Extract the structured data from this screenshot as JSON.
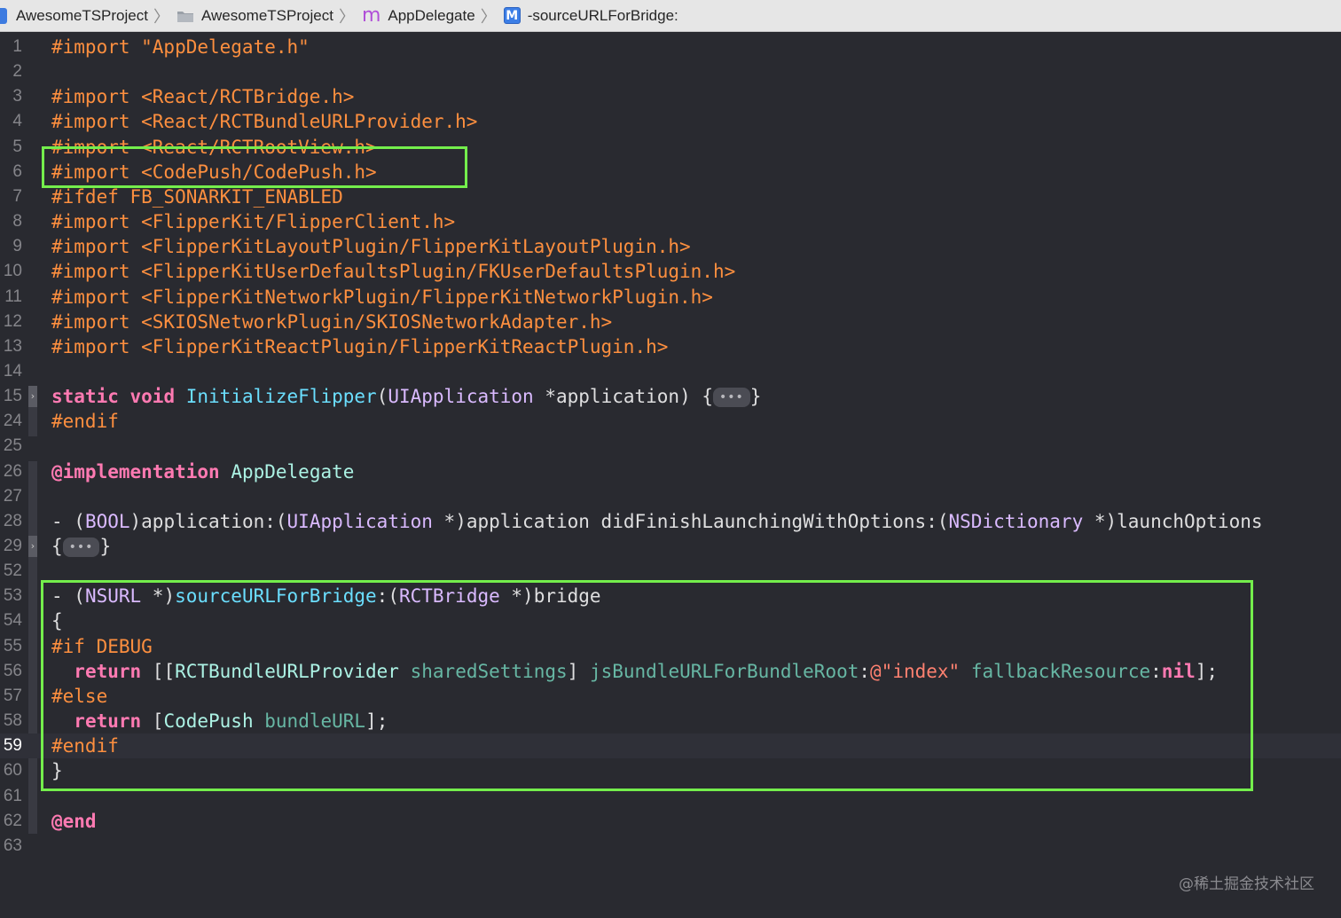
{
  "jump_bar": {
    "project": "AwesomeTSProject",
    "group": "AwesomeTSProject",
    "file_icon_glyph": "m",
    "file": "AppDelegate",
    "method_icon_glyph": "M",
    "method": "-sourceURLForBridge:"
  },
  "editor": {
    "current_line": "59",
    "lines": [
      {
        "n": "1",
        "t": "#import \"AppDelegate.h\""
      },
      {
        "n": "2",
        "t": ""
      },
      {
        "n": "3",
        "t": "#import <React/RCTBridge.h>"
      },
      {
        "n": "4",
        "t": "#import <React/RCTBundleURLProvider.h>"
      },
      {
        "n": "5",
        "t": "#import <React/RCTRootView.h>"
      },
      {
        "n": "6",
        "t": "#import <CodePush/CodePush.h>"
      },
      {
        "n": "7",
        "t": "#ifdef FB_SONARKIT_ENABLED"
      },
      {
        "n": "8",
        "t": "#import <FlipperKit/FlipperClient.h>"
      },
      {
        "n": "9",
        "t": "#import <FlipperKitLayoutPlugin/FlipperKitLayoutPlugin.h>"
      },
      {
        "n": "10",
        "t": "#import <FlipperKitUserDefaultsPlugin/FKUserDefaultsPlugin.h>"
      },
      {
        "n": "11",
        "t": "#import <FlipperKitNetworkPlugin/FlipperKitNetworkPlugin.h>"
      },
      {
        "n": "12",
        "t": "#import <SKIOSNetworkPlugin/SKIOSNetworkAdapter.h>"
      },
      {
        "n": "13",
        "t": "#import <FlipperKitReactPlugin/FlipperKitReactPlugin.h>"
      },
      {
        "n": "14",
        "t": ""
      },
      {
        "n": "15",
        "t": "static void InitializeFlipper(UIApplication *application) {•••}"
      },
      {
        "n": "24",
        "t": "#endif"
      },
      {
        "n": "25",
        "t": ""
      },
      {
        "n": "26",
        "t": "@implementation AppDelegate"
      },
      {
        "n": "27",
        "t": ""
      },
      {
        "n": "28",
        "t": "- (BOOL)application:(UIApplication *)application didFinishLaunchingWithOptions:(NSDictionary *)launchOptions"
      },
      {
        "n": "29",
        "t": "{•••}"
      },
      {
        "n": "52",
        "t": ""
      },
      {
        "n": "53",
        "t": "- (NSURL *)sourceURLForBridge:(RCTBridge *)bridge"
      },
      {
        "n": "54",
        "t": "{"
      },
      {
        "n": "55",
        "t": "#if DEBUG"
      },
      {
        "n": "56",
        "t": "  return [[RCTBundleURLProvider sharedSettings] jsBundleURLForBundleRoot:@\"index\" fallbackResource:nil];"
      },
      {
        "n": "57",
        "t": "#else"
      },
      {
        "n": "58",
        "t": "  return [CodePush bundleURL];"
      },
      {
        "n": "59",
        "t": "#endif"
      },
      {
        "n": "60",
        "t": "}"
      },
      {
        "n": "61",
        "t": ""
      },
      {
        "n": "62",
        "t": "@end"
      },
      {
        "n": "63",
        "t": ""
      }
    ]
  },
  "highlight_color": "#74ee4c",
  "watermark": "@稀土掘金技术社区"
}
